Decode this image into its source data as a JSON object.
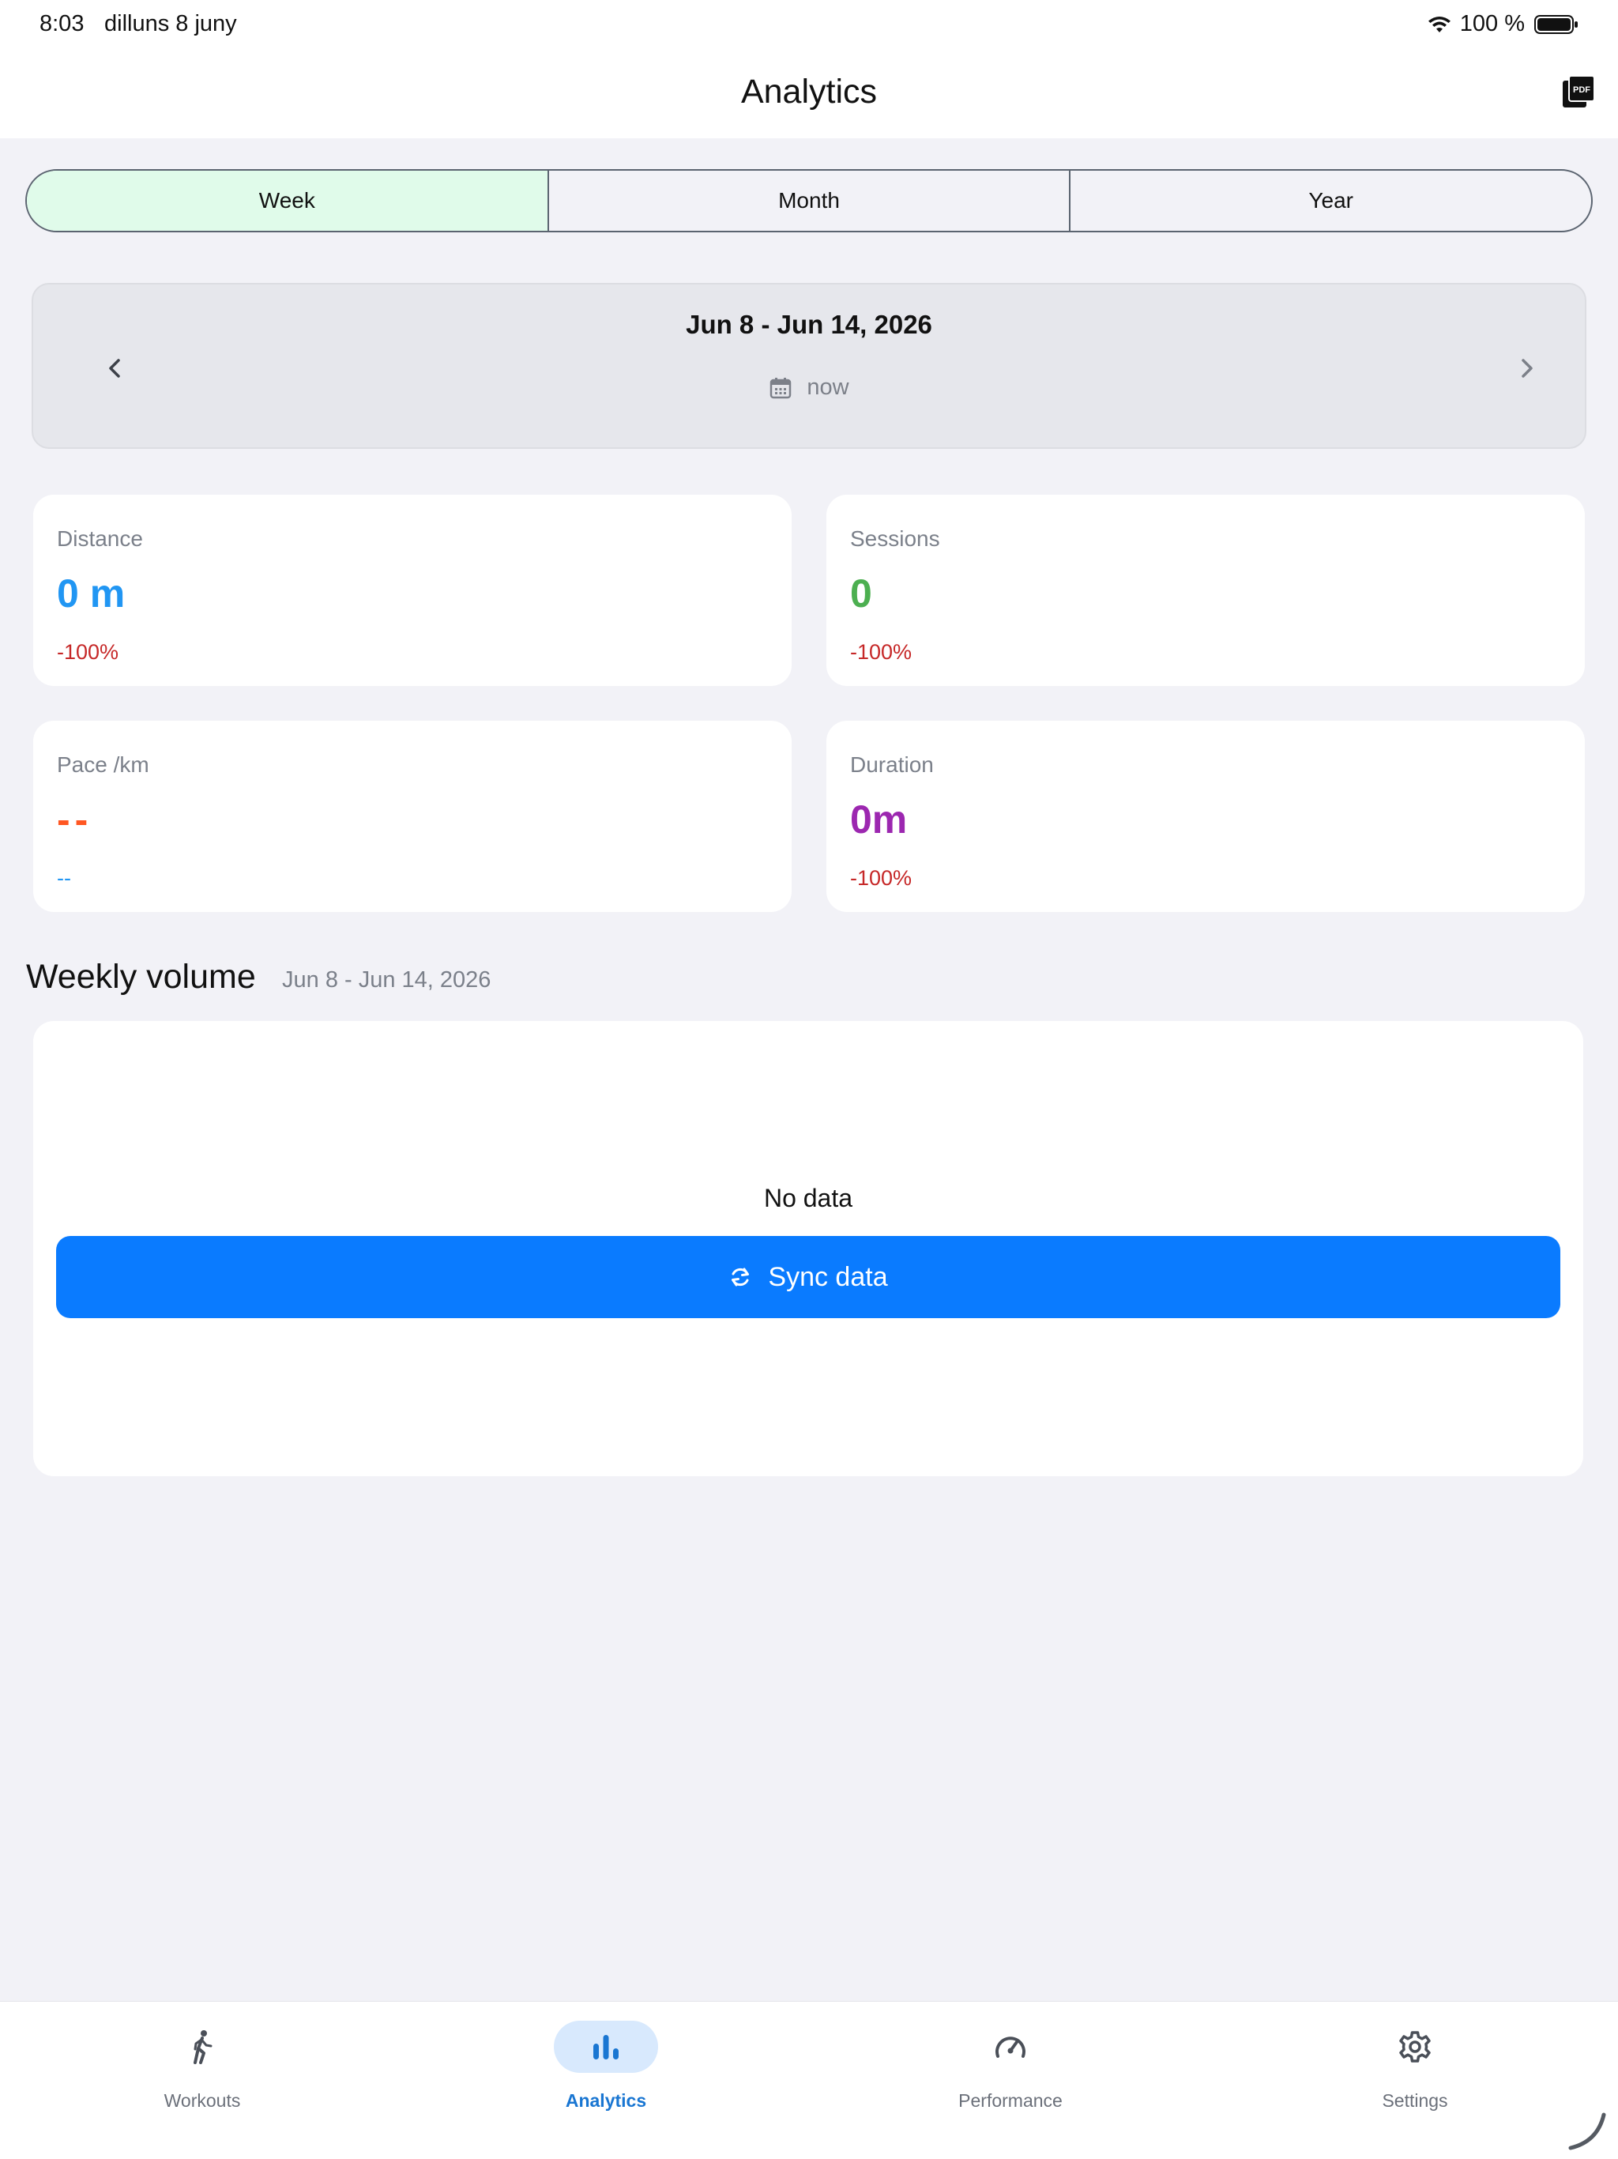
{
  "status_bar": {
    "time": "8:03",
    "date": "dilluns 8 juny",
    "battery": "100 %"
  },
  "nav": {
    "title": "Analytics",
    "pdf_icon": "pdf-export-icon"
  },
  "segments": [
    {
      "label": "Week",
      "active": true
    },
    {
      "label": "Month",
      "active": false
    },
    {
      "label": "Year",
      "active": false
    }
  ],
  "range": {
    "title": "Jun 8 - Jun 14, 2026",
    "subtitle": "now"
  },
  "stats": {
    "distance": {
      "label": "Distance",
      "value": "0 m",
      "change": "-100%",
      "color": "#2196f3",
      "change_color": "#c62828"
    },
    "sessions": {
      "label": "Sessions",
      "value": "0",
      "change": "-100%",
      "color": "#4caf50",
      "change_color": "#c62828"
    },
    "pace": {
      "label": "Pace /km",
      "value": "--",
      "change": "--",
      "color": "#ff5722",
      "change_color": "#2196f3"
    },
    "duration": {
      "label": "Duration",
      "value": "0m",
      "change": "-100%",
      "color": "#9c27b0",
      "change_color": "#c62828"
    }
  },
  "weekly": {
    "title": "Weekly volume",
    "range": "Jun 8 - Jun 14, 2026",
    "empty_text": "No data",
    "sync_label": "Sync data"
  },
  "tabs": [
    {
      "label": "Workouts",
      "icon": "walking-icon",
      "active": false
    },
    {
      "label": "Analytics",
      "icon": "bar-chart-icon",
      "active": true
    },
    {
      "label": "Performance",
      "icon": "speedometer-icon",
      "active": false
    },
    {
      "label": "Settings",
      "icon": "gear-icon",
      "active": false
    }
  ],
  "colors": {
    "accent": "#0a7bff",
    "segment_active": "#e0fbea",
    "tab_active": "#1976d2"
  }
}
